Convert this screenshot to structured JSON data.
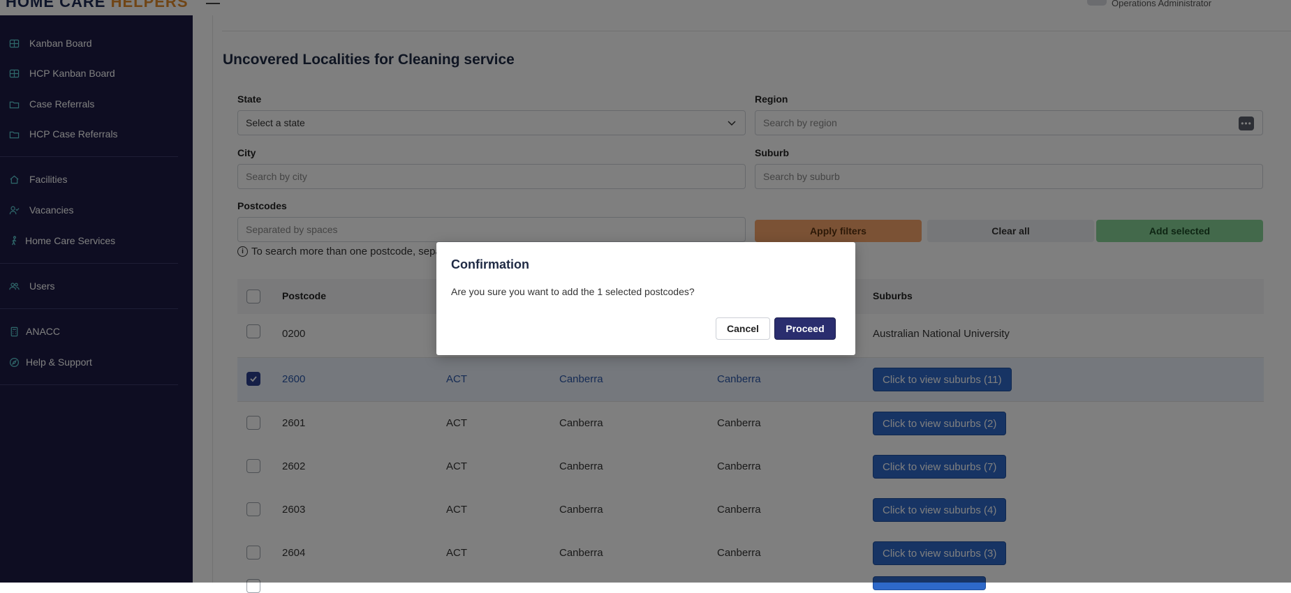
{
  "header": {
    "logo_part1": "HOME CARE",
    "logo_part2": "HELPERS",
    "user_role": "Operations Administrator"
  },
  "sidebar": {
    "items": [
      {
        "label": "Kanban Board",
        "icon": "grid-icon"
      },
      {
        "label": "HCP Kanban Board",
        "icon": "grid-icon"
      },
      {
        "label": "Case Referrals",
        "icon": "folder-icon"
      },
      {
        "label": "HCP Case Referrals",
        "icon": "folder-icon"
      },
      {
        "label": "Facilities",
        "icon": "home-icon"
      },
      {
        "label": "Vacancies",
        "icon": "user-check-icon"
      },
      {
        "label": "Home Care Services",
        "icon": "person-walking-icon"
      },
      {
        "label": "Users",
        "icon": "users-icon"
      },
      {
        "label": "ANACC",
        "icon": "calculator-icon"
      },
      {
        "label": "Help & Support",
        "icon": "compass-icon"
      }
    ]
  },
  "page": {
    "title": "Uncovered Localities for Cleaning service"
  },
  "filters": {
    "state_label": "State",
    "state_value": "Select a state",
    "region_label": "Region",
    "region_placeholder": "Search by region",
    "city_label": "City",
    "city_placeholder": "Search by city",
    "suburb_label": "Suburb",
    "suburb_placeholder": "Search by suburb",
    "postcodes_label": "Postcodes",
    "postcodes_placeholder": "Separated by spaces",
    "hint": "To search more than one postcode, sepa",
    "apply_label": "Apply filters",
    "clear_label": "Clear all",
    "add_label": "Add selected"
  },
  "table": {
    "columns": {
      "postcode": "Postcode",
      "suburbs": "Suburbs"
    },
    "rows": [
      {
        "postcode": "0200",
        "state": "",
        "city": "",
        "region": "",
        "suburbs": "Australian National University",
        "is_button": false,
        "checked": false
      },
      {
        "postcode": "2600",
        "state": "ACT",
        "city": "Canberra",
        "region": "Canberra",
        "suburbs": "Click to view suburbs (11)",
        "is_button": true,
        "checked": true
      },
      {
        "postcode": "2601",
        "state": "ACT",
        "city": "Canberra",
        "region": "Canberra",
        "suburbs": "Click to view suburbs (2)",
        "is_button": true,
        "checked": false
      },
      {
        "postcode": "2602",
        "state": "ACT",
        "city": "Canberra",
        "region": "Canberra",
        "suburbs": "Click to view suburbs (7)",
        "is_button": true,
        "checked": false
      },
      {
        "postcode": "2603",
        "state": "ACT",
        "city": "Canberra",
        "region": "Canberra",
        "suburbs": "Click to view suburbs (4)",
        "is_button": true,
        "checked": false
      },
      {
        "postcode": "2604",
        "state": "ACT",
        "city": "Canberra",
        "region": "Canberra",
        "suburbs": "Click to view suburbs (3)",
        "is_button": true,
        "checked": false
      }
    ]
  },
  "modal": {
    "title": "Confirmation",
    "message": "Are you sure you want to add the 1 selected postcodes?",
    "cancel_label": "Cancel",
    "proceed_label": "Proceed"
  },
  "colors": {
    "sidebar_bg": "#1c1b45",
    "icon_accent": "#5fd0d6",
    "apply_btn": "#f6a56b",
    "add_btn": "#86d296",
    "suburb_btn": "#2e69c9",
    "proceed_btn": "#2a2d6e"
  }
}
